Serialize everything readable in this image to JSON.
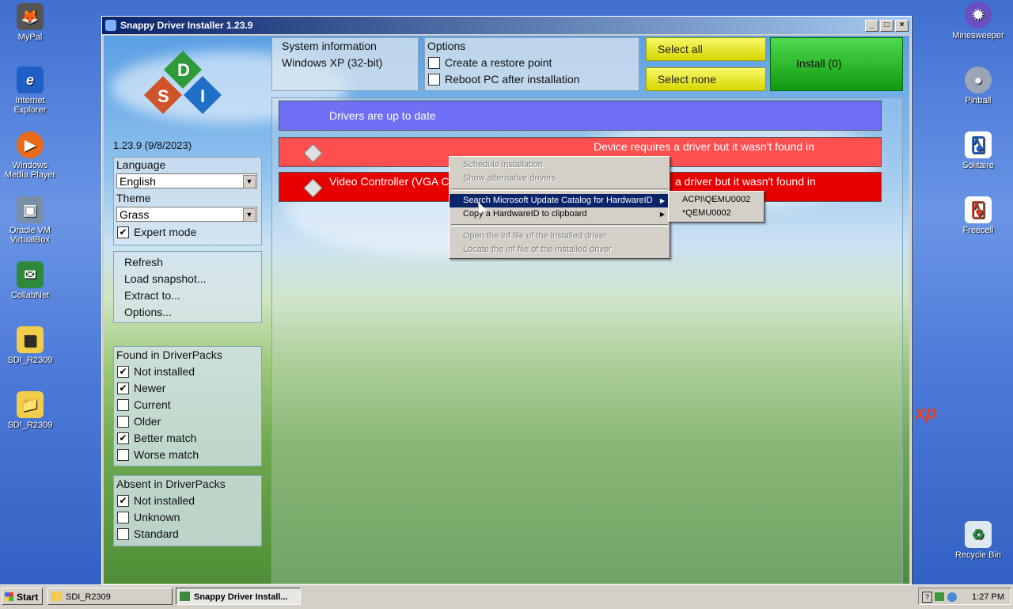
{
  "desktop": {
    "left_icons": [
      {
        "label": "MyPal",
        "glyph": "🦊"
      },
      {
        "label": "Internet Explorer",
        "glyph": "e"
      },
      {
        "label": "Windows Media Player",
        "glyph": "▶"
      },
      {
        "label": "Oracle VM VirtualBox",
        "glyph": "▣"
      },
      {
        "label": "CollabNet",
        "glyph": "✉"
      },
      {
        "label": "SDI_R2309",
        "glyph": "▤"
      },
      {
        "label": "SDI_R2309",
        "glyph": "📁"
      }
    ],
    "right_icons": [
      {
        "label": "Minesweeper",
        "glyph": "✹"
      },
      {
        "label": "Pinball",
        "glyph": "●"
      },
      {
        "label": "Solitaire",
        "glyph": "🂡"
      },
      {
        "label": "Freecell",
        "glyph": "🂱"
      },
      {
        "label": "Recycle Bin",
        "glyph": "♻"
      }
    ],
    "xp_mark": "xp"
  },
  "window": {
    "title": "Snappy Driver Installer 1.23.9",
    "controls": [
      "_",
      "□",
      "×"
    ]
  },
  "app": {
    "logo_letters": [
      "S",
      "D",
      "I"
    ],
    "version": "1.23.9 (9/8/2023)",
    "sysinfo": {
      "title": "System information",
      "os": "Windows XP (32-bit)"
    },
    "options": {
      "title": "Options",
      "items": [
        {
          "label": "Create a restore point",
          "checked": false
        },
        {
          "label": "Reboot PC after installation",
          "checked": false
        }
      ]
    },
    "select_all": "Select all",
    "select_none": "Select none",
    "install": "Install (0)",
    "language": {
      "label": "Language",
      "value": "English"
    },
    "theme": {
      "label": "Theme",
      "value": "Grass"
    },
    "expert_mode": {
      "label": "Expert mode",
      "checked": true
    },
    "actions": [
      "Refresh",
      "Load snapshot...",
      "Extract to...",
      "Options..."
    ],
    "found": {
      "title": "Found in DriverPacks",
      "items": [
        {
          "label": "Not installed",
          "checked": true
        },
        {
          "label": "Newer",
          "checked": true
        },
        {
          "label": "Current",
          "checked": false
        },
        {
          "label": "Older",
          "checked": false
        },
        {
          "label": "Better match",
          "checked": true
        },
        {
          "label": "Worse match",
          "checked": false
        }
      ]
    },
    "absent": {
      "title": "Absent in DriverPacks",
      "items": [
        {
          "label": "Not installed",
          "checked": true
        },
        {
          "label": "Unknown",
          "checked": false
        },
        {
          "label": "Standard",
          "checked": false
        }
      ]
    },
    "rows": [
      {
        "text": "Drivers are up to date",
        "color": "#6f6ff5"
      },
      {
        "name": "",
        "status": "Device requires a driver but it wasn't found in",
        "color": "#ff4f4f"
      },
      {
        "name": "Video Controller (VGA C",
        "status": "a driver but it wasn't found in",
        "color": "#e60000"
      }
    ]
  },
  "context_menu": {
    "items": [
      {
        "label": "Schedule installation",
        "disabled": true
      },
      {
        "label": "Show alternative drivers",
        "disabled": true
      },
      {
        "label": "Search Microsoft Update Catalog for HardwareID",
        "selected": true,
        "submenu": true
      },
      {
        "label": "Copy a HardwareID to clipboard",
        "submenu": true
      },
      {
        "label": "Open the inf file of the installed driver",
        "disabled": true
      },
      {
        "label": "Locate the inf file of the installed driver",
        "disabled": true
      }
    ],
    "submenu": [
      "ACPI\\QEMU0002",
      "*QEMU0002"
    ]
  },
  "taskbar": {
    "start": "Start",
    "tasks": [
      {
        "label": "SDI_R2309",
        "active": false
      },
      {
        "label": "Snappy Driver Install...",
        "active": true
      }
    ],
    "clock": "1:27 PM"
  }
}
